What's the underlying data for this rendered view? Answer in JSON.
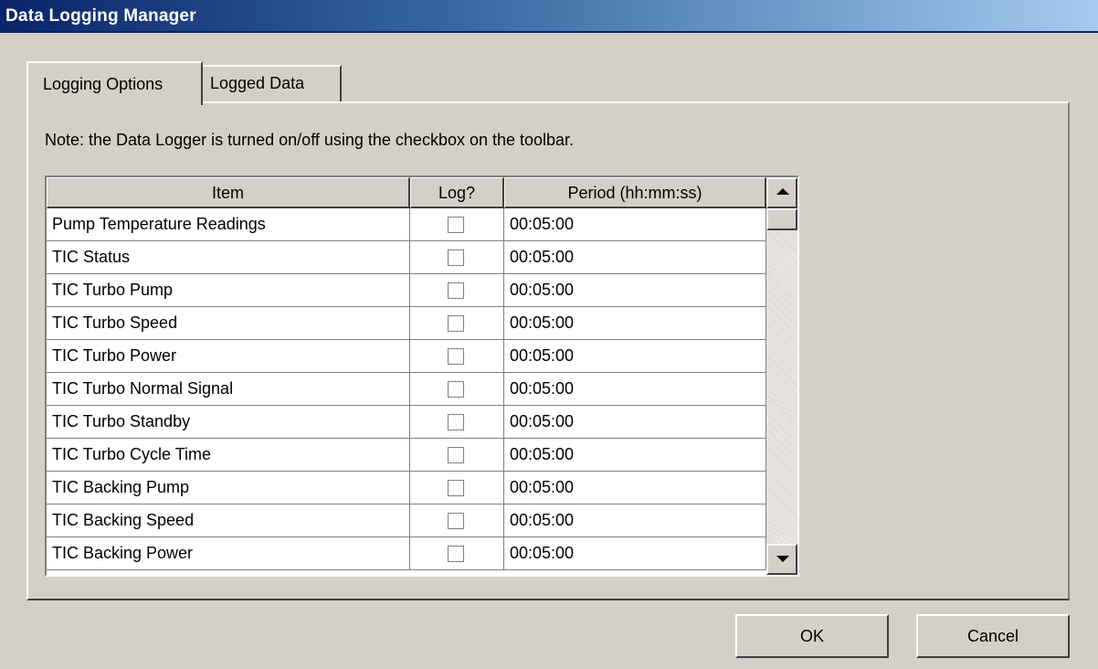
{
  "window": {
    "title": "Data Logging Manager"
  },
  "tabs": [
    {
      "label": "Logging Options",
      "active": true
    },
    {
      "label": "Logged Data",
      "active": false
    }
  ],
  "note": "Note: the Data Logger is turned on/off using the checkbox on the toolbar.",
  "grid": {
    "columns": [
      "Item",
      "Log?",
      "Period (hh:mm:ss)"
    ],
    "rows": [
      {
        "item": "Pump Temperature Readings",
        "log": false,
        "period": "00:05:00"
      },
      {
        "item": "TIC Status",
        "log": false,
        "period": "00:05:00"
      },
      {
        "item": "TIC Turbo Pump",
        "log": false,
        "period": "00:05:00"
      },
      {
        "item": "TIC Turbo Speed",
        "log": false,
        "period": "00:05:00"
      },
      {
        "item": "TIC Turbo Power",
        "log": false,
        "period": "00:05:00"
      },
      {
        "item": "TIC Turbo Normal Signal",
        "log": false,
        "period": "00:05:00"
      },
      {
        "item": "TIC Turbo Standby",
        "log": false,
        "period": "00:05:00"
      },
      {
        "item": "TIC Turbo Cycle Time",
        "log": false,
        "period": "00:05:00"
      },
      {
        "item": "TIC Backing Pump",
        "log": false,
        "period": "00:05:00"
      },
      {
        "item": "TIC Backing Speed",
        "log": false,
        "period": "00:05:00"
      },
      {
        "item": "TIC Backing Power",
        "log": false,
        "period": "00:05:00"
      }
    ]
  },
  "buttons": {
    "ok": "OK",
    "cancel": "Cancel"
  },
  "colors": {
    "face": "#d4d0c8",
    "title_start": "#0a246a",
    "title_end": "#a6caf0"
  }
}
